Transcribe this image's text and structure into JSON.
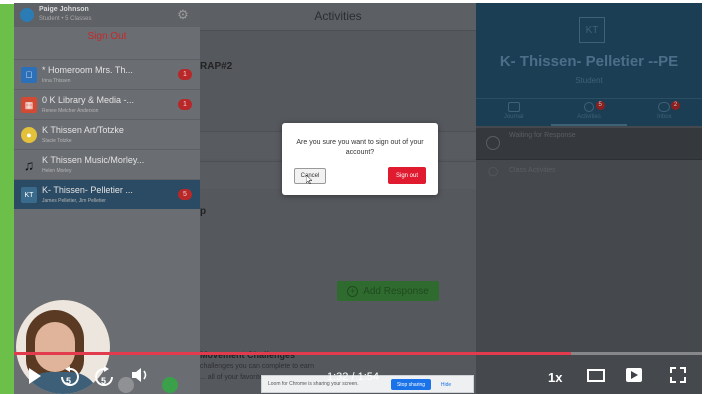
{
  "app": {
    "header_title": "Activities",
    "partial_label_1": "RAP#2",
    "partial_label_2": "p",
    "partial_label_3": "Movement Challenges",
    "partial_line_1": "challenges you can complete to earn",
    "partial_line_2": "... all of your favorite",
    "add_response_label": "Add Response"
  },
  "user": {
    "name": "Paige Johnson",
    "subtitle": "Student • 5 Classes",
    "signout_label": "Sign Out"
  },
  "classes": [
    {
      "title": "* Homeroom Mrs. Th...",
      "subtitle": "Irina Thissen",
      "badge": "1",
      "icon_color": "#2b70b8",
      "icon": "apple-icon"
    },
    {
      "title": "0 K Library & Media -...",
      "subtitle": "Renee Melcher Anderson",
      "badge": "1",
      "icon_color": "#d24a33",
      "icon": "book-icon"
    },
    {
      "title": "K Thissen Art/Totzke",
      "subtitle": "Stacie Totzke",
      "badge": "",
      "icon_color": "#e3c13a",
      "icon": "palette-icon"
    },
    {
      "title": "K Thissen Music/Morley...",
      "subtitle": "Helen Morley",
      "badge": "",
      "icon_color": "#444",
      "icon": "music-note-icon"
    },
    {
      "title": "K- Thissen- Pelletier ...",
      "subtitle": "James Pelletier, Jim Pelletier",
      "badge": "5",
      "icon_color": "#2b4b63",
      "icon": "KT"
    }
  ],
  "profile": {
    "initials": "KT",
    "name": "K- Thissen- Pelletier --PE",
    "role": "Student",
    "tabs": [
      {
        "label": "Journal",
        "badge": ""
      },
      {
        "label": "Activities",
        "badge": "5"
      },
      {
        "label": "Inbox",
        "badge": "2"
      }
    ],
    "waiting_label": "Waiting for Response",
    "class_activities_label": "Class Activities"
  },
  "modal": {
    "message": "Are you sure you want to sign out of your account?",
    "cancel_label": "Cancel",
    "signout_label": "Sign out"
  },
  "share_bar": {
    "message": "Loom for Chrome is sharing your screen.",
    "stop_label": "Stop sharing",
    "hide_label": "Hide"
  },
  "player": {
    "time": "1:32 / 1:54",
    "speed": "1x",
    "progress": 0.81,
    "skip_back_seconds": "5",
    "skip_forward_seconds": "5"
  },
  "colors": {
    "accent_green": "#6cc04a",
    "progress_red": "#e33b4e",
    "signout_red": "#e01a2f",
    "profile_blue": "#1c3e55"
  }
}
